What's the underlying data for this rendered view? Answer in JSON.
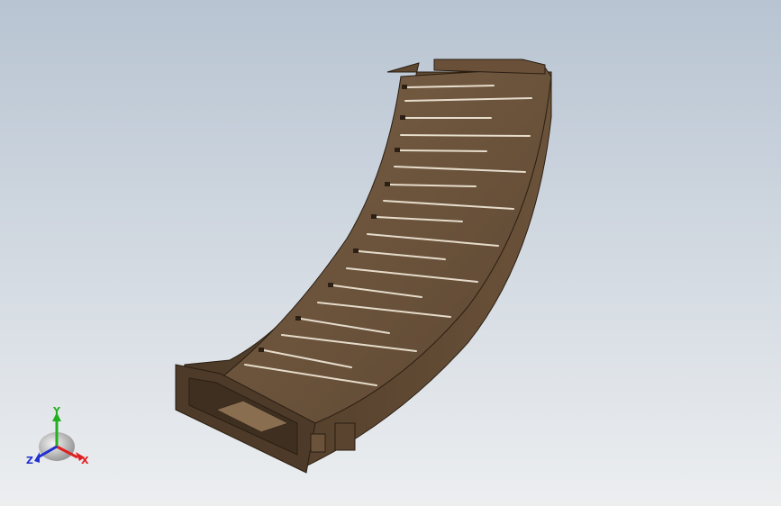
{
  "viewport": {
    "background_top": "#b9c5d3",
    "background_bottom": "#e9ecef",
    "model_color": "#5a4430"
  },
  "triad": {
    "x_label": "X",
    "y_label": "Y",
    "z_label": "Z",
    "x_color": "#e02020",
    "y_color": "#22b022",
    "z_color": "#2030d0"
  }
}
